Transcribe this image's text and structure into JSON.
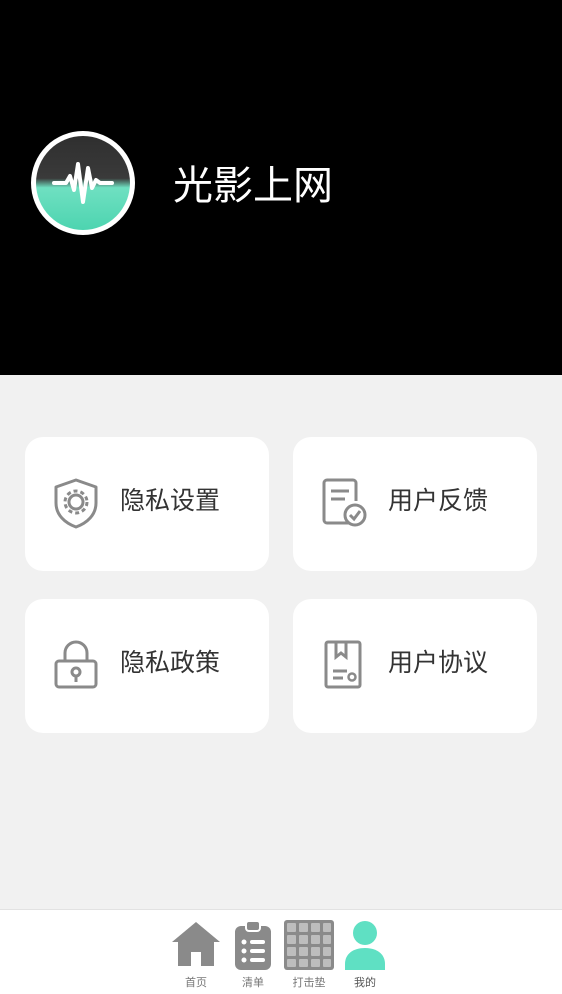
{
  "header": {
    "app_name": "光影上网",
    "logo_icon": "waveform-logo-icon"
  },
  "cards": [
    {
      "label": "隐私设置",
      "icon": "shield-gear-icon"
    },
    {
      "label": "用户反馈",
      "icon": "document-check-icon"
    },
    {
      "label": "隐私政策",
      "icon": "padlock-icon"
    },
    {
      "label": "用户协议",
      "icon": "bookmark-document-icon"
    }
  ],
  "tabbar": {
    "items": [
      {
        "label": "首页",
        "icon": "home-icon",
        "active": false
      },
      {
        "label": "清单",
        "icon": "clipboard-list-icon",
        "active": false
      },
      {
        "label": "打击垫",
        "icon": "pad-grid-icon",
        "active": false
      },
      {
        "label": "我的",
        "icon": "person-icon",
        "active": true
      }
    ]
  },
  "colors": {
    "header_bg": "#000000",
    "page_bg": "#f1f1f1",
    "accent": "#5fe0c3",
    "icon_gray": "#8a8a8a"
  }
}
